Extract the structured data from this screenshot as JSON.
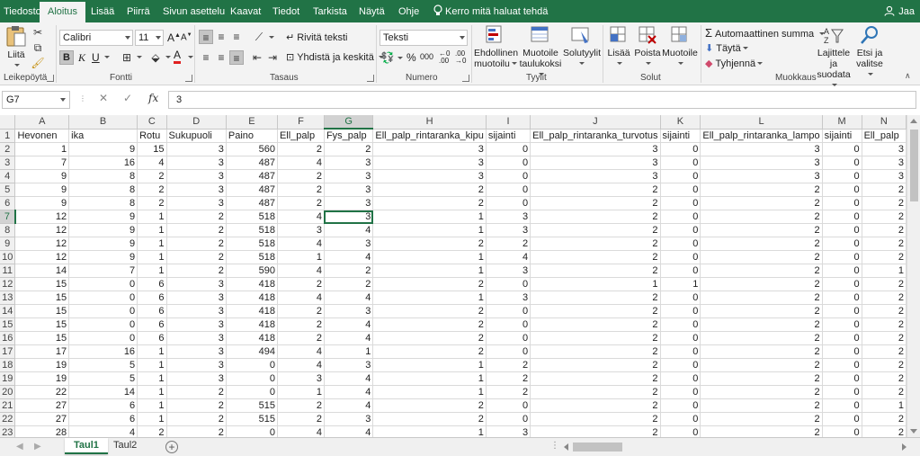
{
  "colors": {
    "accent": "#217346"
  },
  "ribbon_tabs": [
    "Tiedosto",
    "Aloitus",
    "Lisää",
    "Piirrä",
    "Sivun asettelu",
    "Kaavat",
    "Tiedot",
    "Tarkista",
    "Näytä",
    "Ohje"
  ],
  "tell_me": "Kerro mitä haluat tehdä",
  "share": "Jaa",
  "ribbon": {
    "paste": "Liitä",
    "clipboard_group": "Leikepöytä",
    "font_name": "Calibri",
    "font_size": "11",
    "bold": "B",
    "italic": "K",
    "underline": "U",
    "font_group": "Fontti",
    "wrap_text": "Rivitä teksti",
    "merge_center": "Yhdistä ja keskitä",
    "alignment_group": "Tasaus",
    "number_format": "Teksti",
    "number_group": "Numero",
    "conditional_formatting": [
      "Ehdollinen",
      "muotoilu"
    ],
    "format_as_table": [
      "Muotoile",
      "taulukoksi"
    ],
    "cell_styles": "Solutyylit",
    "styles_group": "Tyylit",
    "insert": "Lisää",
    "delete": "Poista",
    "format": "Muotoile",
    "cells_group": "Solut",
    "autosum": "Automaattinen summa",
    "fill": "Täytä",
    "clear": "Tyhjennä",
    "sort_filter": [
      "Lajittele ja",
      "suodata"
    ],
    "find_select": [
      "Etsi ja",
      "valitse"
    ],
    "editing_group": "Muokkaus"
  },
  "formula_bar": {
    "name_box": "G7",
    "formula": "3",
    "fx": "fx"
  },
  "grid": {
    "columns": [
      "A",
      "B",
      "C",
      "D",
      "E",
      "F",
      "G",
      "H",
      "I",
      "J",
      "K",
      "L",
      "M",
      "N"
    ],
    "selected_column": "G",
    "selected_row": 7,
    "rows": [
      [
        "Hevonen",
        "ika",
        "Rotu",
        "Sukupuoli",
        "Paino",
        "Ell_palp",
        "Fys_palp",
        "Ell_palp_rintaranka_kipu",
        "sijainti",
        "Ell_palp_rintaranka_turvotus",
        "sijainti",
        "Ell_palp_rintaranka_lampo",
        "sijainti",
        "Ell_palp"
      ],
      [
        "1",
        "9",
        "15",
        "3",
        "560",
        "2",
        "2",
        "3",
        "0",
        "3",
        "0",
        "3",
        "0",
        "3"
      ],
      [
        "7",
        "16",
        "4",
        "3",
        "487",
        "4",
        "3",
        "3",
        "0",
        "3",
        "0",
        "3",
        "0",
        "3"
      ],
      [
        "9",
        "8",
        "2",
        "3",
        "487",
        "2",
        "3",
        "3",
        "0",
        "3",
        "0",
        "3",
        "0",
        "3"
      ],
      [
        "9",
        "8",
        "2",
        "3",
        "487",
        "2",
        "3",
        "2",
        "0",
        "2",
        "0",
        "2",
        "0",
        "2"
      ],
      [
        "9",
        "8",
        "2",
        "3",
        "487",
        "2",
        "3",
        "2",
        "0",
        "2",
        "0",
        "2",
        "0",
        "2"
      ],
      [
        "12",
        "9",
        "1",
        "2",
        "518",
        "4",
        "3",
        "1",
        "3",
        "2",
        "0",
        "2",
        "0",
        "2"
      ],
      [
        "12",
        "9",
        "1",
        "2",
        "518",
        "3",
        "4",
        "1",
        "3",
        "2",
        "0",
        "2",
        "0",
        "2"
      ],
      [
        "12",
        "9",
        "1",
        "2",
        "518",
        "4",
        "3",
        "2",
        "2",
        "2",
        "0",
        "2",
        "0",
        "2"
      ],
      [
        "12",
        "9",
        "1",
        "2",
        "518",
        "1",
        "4",
        "1",
        "4",
        "2",
        "0",
        "2",
        "0",
        "2"
      ],
      [
        "14",
        "7",
        "1",
        "2",
        "590",
        "4",
        "2",
        "1",
        "3",
        "2",
        "0",
        "2",
        "0",
        "1"
      ],
      [
        "15",
        "0",
        "6",
        "3",
        "418",
        "2",
        "2",
        "2",
        "0",
        "1",
        "1",
        "2",
        "0",
        "2"
      ],
      [
        "15",
        "0",
        "6",
        "3",
        "418",
        "4",
        "4",
        "1",
        "3",
        "2",
        "0",
        "2",
        "0",
        "2"
      ],
      [
        "15",
        "0",
        "6",
        "3",
        "418",
        "2",
        "3",
        "2",
        "0",
        "2",
        "0",
        "2",
        "0",
        "2"
      ],
      [
        "15",
        "0",
        "6",
        "3",
        "418",
        "2",
        "4",
        "2",
        "0",
        "2",
        "0",
        "2",
        "0",
        "2"
      ],
      [
        "15",
        "0",
        "6",
        "3",
        "418",
        "2",
        "4",
        "2",
        "0",
        "2",
        "0",
        "2",
        "0",
        "2"
      ],
      [
        "17",
        "16",
        "1",
        "3",
        "494",
        "4",
        "1",
        "2",
        "0",
        "2",
        "0",
        "2",
        "0",
        "2"
      ],
      [
        "19",
        "5",
        "1",
        "3",
        "0",
        "4",
        "3",
        "1",
        "2",
        "2",
        "0",
        "2",
        "0",
        "2"
      ],
      [
        "19",
        "5",
        "1",
        "3",
        "0",
        "3",
        "4",
        "1",
        "2",
        "2",
        "0",
        "2",
        "0",
        "2"
      ],
      [
        "22",
        "14",
        "1",
        "2",
        "0",
        "1",
        "4",
        "1",
        "2",
        "2",
        "0",
        "2",
        "0",
        "2"
      ],
      [
        "27",
        "6",
        "1",
        "2",
        "515",
        "2",
        "4",
        "2",
        "0",
        "2",
        "0",
        "2",
        "0",
        "1"
      ],
      [
        "27",
        "6",
        "1",
        "2",
        "515",
        "2",
        "3",
        "2",
        "0",
        "2",
        "0",
        "2",
        "0",
        "2"
      ],
      [
        "28",
        "4",
        "2",
        "2",
        "0",
        "4",
        "4",
        "1",
        "3",
        "2",
        "0",
        "2",
        "0",
        "2"
      ]
    ]
  },
  "sheets": [
    "Taul1",
    "Taul2"
  ],
  "active_sheet": "Taul1"
}
